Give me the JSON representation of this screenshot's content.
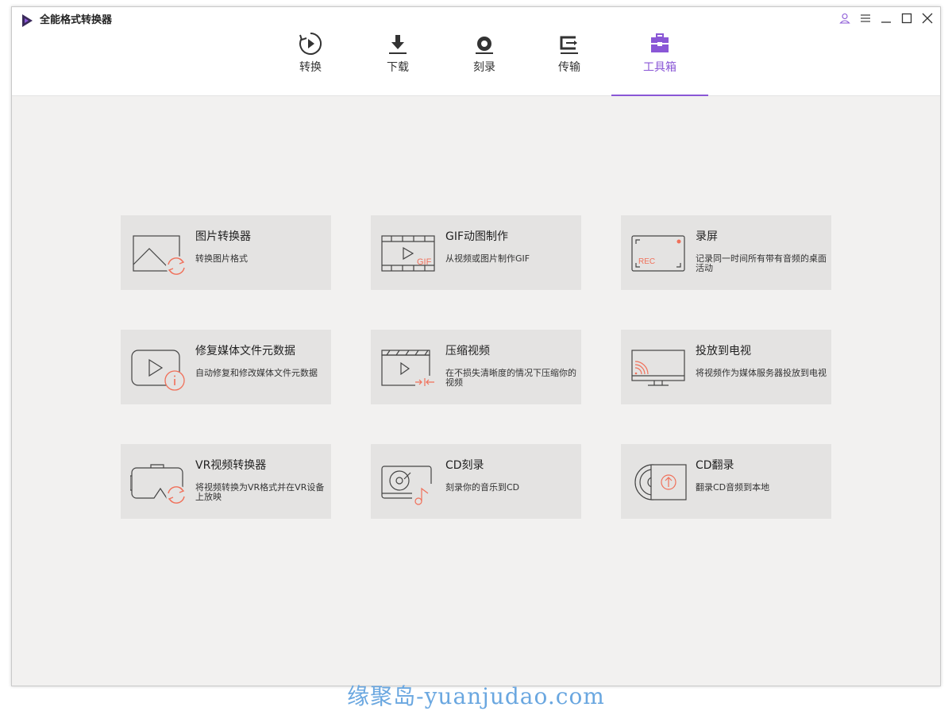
{
  "app": {
    "title": "全能格式转换器"
  },
  "nav": [
    {
      "label": "转换",
      "icon": "convert-icon"
    },
    {
      "label": "下载",
      "icon": "download-icon"
    },
    {
      "label": "刻录",
      "icon": "burn-icon"
    },
    {
      "label": "传输",
      "icon": "transfer-icon"
    },
    {
      "label": "工具箱",
      "icon": "toolbox-icon",
      "active": true
    }
  ],
  "tools": [
    {
      "title": "图片转换器",
      "desc": "转换图片格式",
      "icon": "image-convert-icon"
    },
    {
      "title": "GIF动图制作",
      "desc": "从视频或图片制作GIF",
      "icon": "gif-maker-icon"
    },
    {
      "title": "录屏",
      "desc": "记录同一时间所有带有音频的桌面活动",
      "icon": "screen-record-icon"
    },
    {
      "title": "修复媒体文件元数据",
      "desc": "自动修复和修改媒体文件元数据",
      "icon": "metadata-fix-icon"
    },
    {
      "title": "压缩视频",
      "desc": "在不损失清晰度的情况下压缩你的视频",
      "icon": "compress-video-icon"
    },
    {
      "title": "投放到电视",
      "desc": "将视频作为媒体服务器投放到电视",
      "icon": "cast-tv-icon"
    },
    {
      "title": "VR视频转换器",
      "desc": "将视频转换为VR格式并在VR设备上放映",
      "icon": "vr-convert-icon"
    },
    {
      "title": "CD刻录",
      "desc": "刻录你的音乐到CD",
      "icon": "cd-burn-icon"
    },
    {
      "title": "CD翻录",
      "desc": "翻录CD音频到本地",
      "icon": "cd-rip-icon"
    }
  ],
  "watermark": "缘聚岛-yuanjudao.com",
  "colors": {
    "accent": "#8a57d6",
    "icon_highlight": "#f0705a",
    "card_bg": "#e4e3e2",
    "content_bg": "#f2f1f0"
  }
}
